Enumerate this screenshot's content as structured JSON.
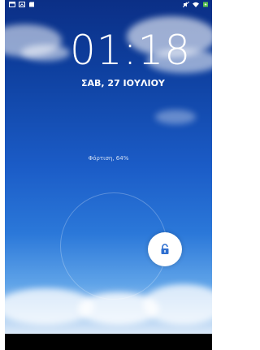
{
  "status": {
    "left_icons": [
      "calendar-icon",
      "screenshot-icon",
      "sd-card-icon"
    ],
    "right_icons": [
      "mute-icon",
      "wifi-icon",
      "battery-charging-icon"
    ]
  },
  "lock": {
    "time": "01:18",
    "date": "ΣΑΒ, 27 ΙΟΥΛΙΟΥ",
    "charging": "Φόρτιση, 64%",
    "battery_level": 0.64,
    "unlock_icon": "unlock-icon"
  },
  "colors": {
    "sky_top": "#0b2f86",
    "sky_mid": "#1b5cc7",
    "clouds": "#dbe9f8"
  }
}
